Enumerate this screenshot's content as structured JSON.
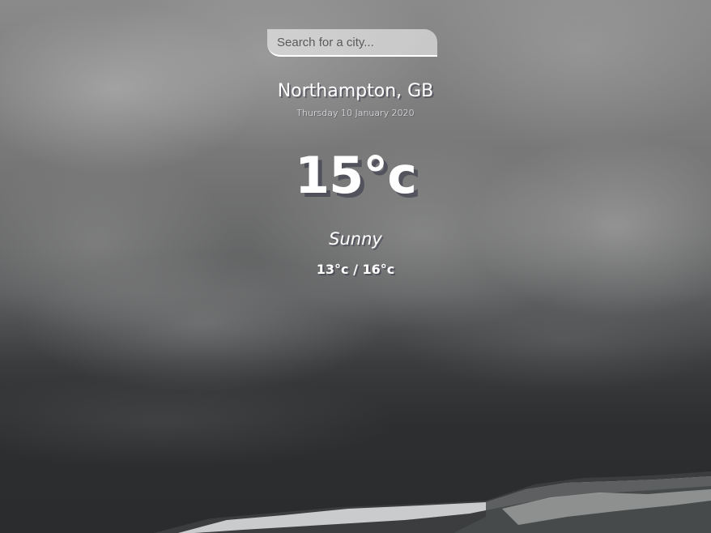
{
  "search": {
    "placeholder": "Search for a city...",
    "value": ""
  },
  "location": {
    "city_country": "Northampton, GB",
    "date": "Thursday 10 January 2020"
  },
  "weather": {
    "temperature": "15°c",
    "condition": "Sunny",
    "low_high": "13°c / 16°c"
  },
  "colors": {
    "text": "#ffffff",
    "search_background": "rgba(255,255,255,0.55)",
    "sky_top": "#8a8a8a",
    "sky_bottom": "#2a2c2e"
  }
}
